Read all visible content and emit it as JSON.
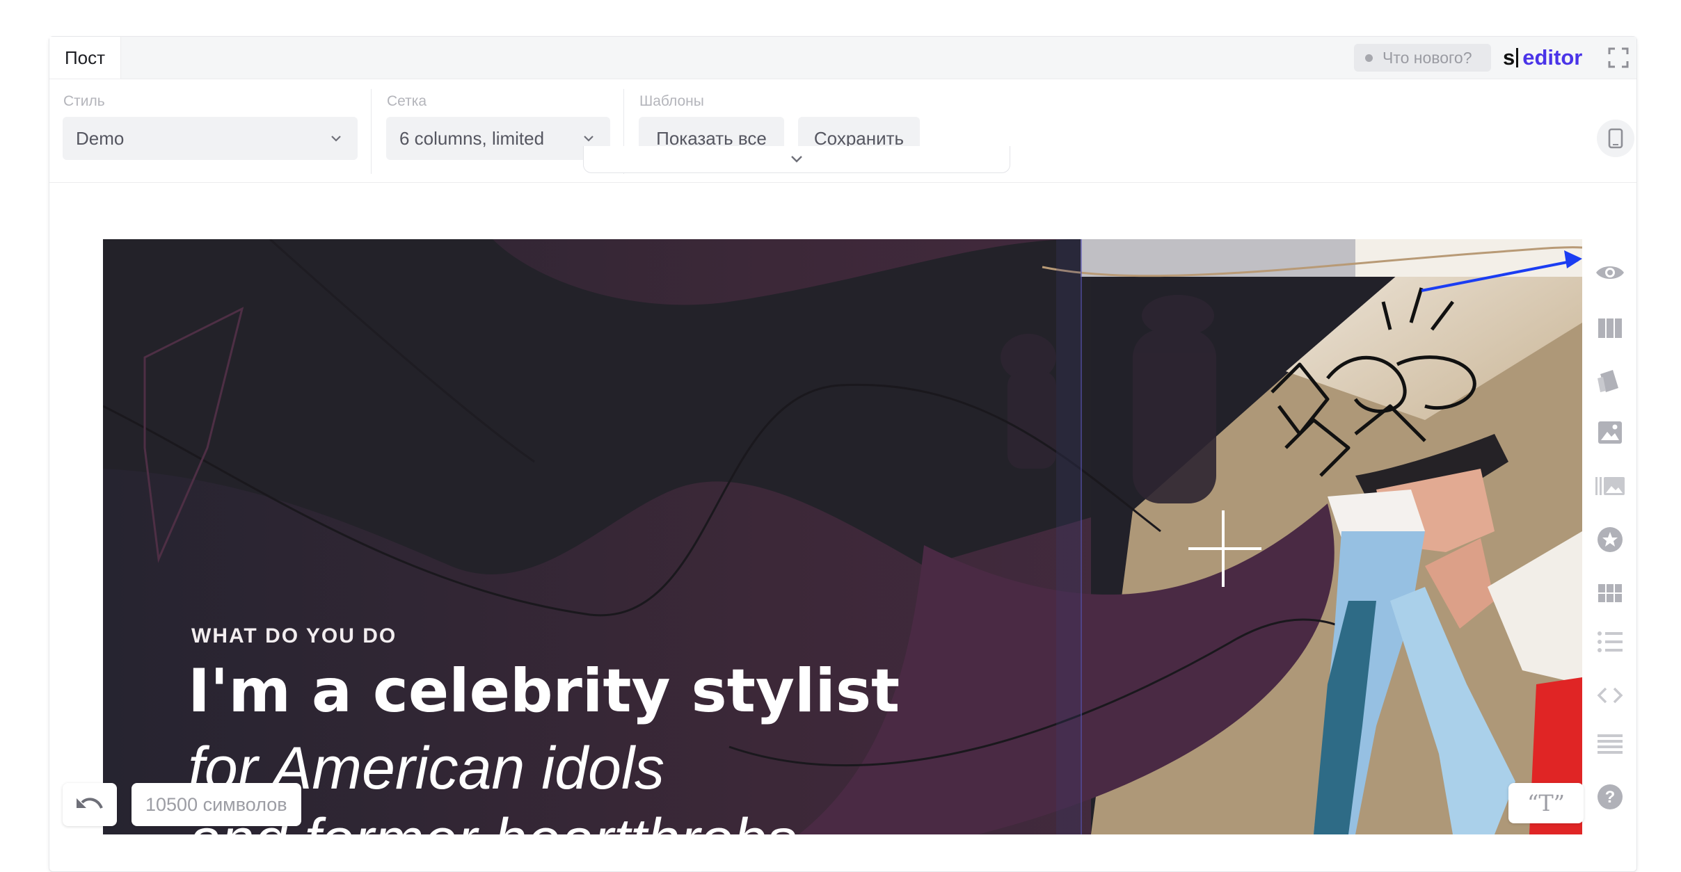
{
  "editor": {
    "tab": "Пост",
    "whats_new": "Что нового?",
    "brand_s": "s",
    "brand_name": "editor"
  },
  "settings": {
    "style_label": "Стиль",
    "style_value": "Demo",
    "grid_label": "Сетка",
    "grid_value": "6 columns, limited",
    "templates_label": "Шаблоны",
    "show_all": "Показать все",
    "save": "Сохранить"
  },
  "cover": {
    "kicker": "WHAT DO YOU DO",
    "headline": "I'm a celebrity stylist",
    "line2": "for American idols",
    "line3": "and former heartthrobs"
  },
  "footer": {
    "char_count": "10500 символов",
    "quote_button": "“T”"
  },
  "toolbar_icons": [
    "eye-icon",
    "columns-icon",
    "cards-icon",
    "image-icon",
    "gallery-icon",
    "star-icon",
    "grid-icon",
    "list-icon",
    "code-icon",
    "table-icon",
    "help-icon"
  ],
  "colors": {
    "brand": "#4a34e8",
    "cover_bg": "#2e2330",
    "annotation_arrow": "#1b3df2"
  }
}
